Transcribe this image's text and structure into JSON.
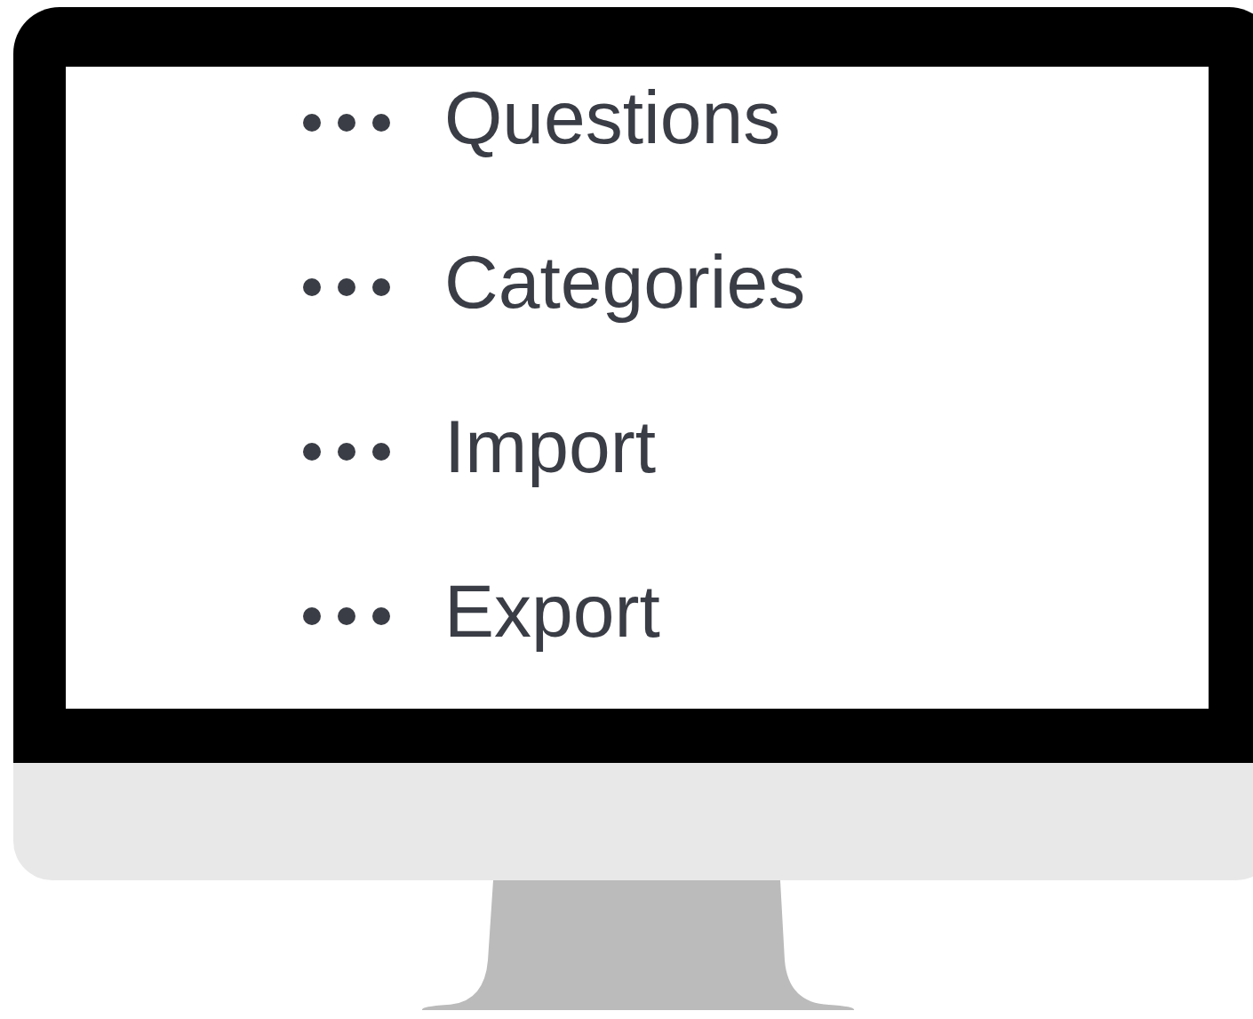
{
  "menu": {
    "items": [
      {
        "label": "Questions"
      },
      {
        "label": "Categories"
      },
      {
        "label": "Import"
      },
      {
        "label": "Export"
      }
    ]
  }
}
